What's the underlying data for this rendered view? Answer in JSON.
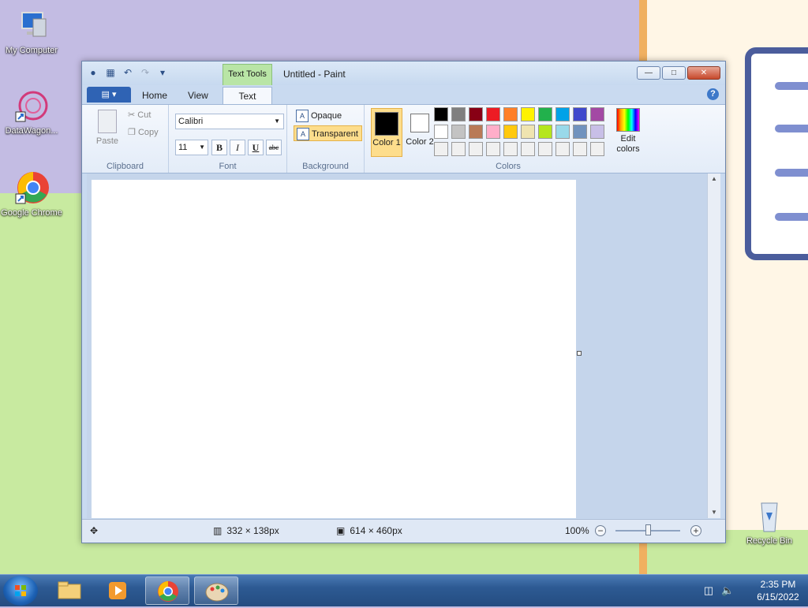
{
  "desktop": {
    "icons": [
      {
        "label": "My Computer"
      },
      {
        "label": "DataWagon..."
      },
      {
        "label": "Google Chrome"
      },
      {
        "label": "Recycle Bin"
      }
    ]
  },
  "window": {
    "title": "Untitled - Paint",
    "contextual_tab": "Text Tools",
    "tabs": [
      {
        "label": "Home"
      },
      {
        "label": "View"
      },
      {
        "label": "Text"
      }
    ],
    "active_tab": "Text"
  },
  "ribbon": {
    "clipboard": {
      "label": "Clipboard",
      "paste": "Paste",
      "cut": "Cut",
      "copy": "Copy"
    },
    "font": {
      "label": "Font",
      "family": "Calibri",
      "size": "11",
      "bold": "B",
      "italic": "I",
      "underline": "U",
      "strike": "abc"
    },
    "background": {
      "label": "Background",
      "opaque": "Opaque",
      "transparent": "Transparent"
    },
    "colors": {
      "label": "Colors",
      "color1": "Color 1",
      "color2": "Color 2",
      "edit": "Edit colors",
      "color1_value": "#000000",
      "color2_value": "#ffffff",
      "palette": [
        "#000000",
        "#7f7f7f",
        "#880015",
        "#ed1c24",
        "#ff7f27",
        "#fff200",
        "#22b14c",
        "#00a2e8",
        "#3f48cc",
        "#a349a4",
        "#ffffff",
        "#c3c3c3",
        "#b97a57",
        "#ffaec9",
        "#ffc90e",
        "#efe4b0",
        "#b5e61d",
        "#99d9ea",
        "#7092be",
        "#c8bfe7",
        "#f0f0f0",
        "#f0f0f0",
        "#f0f0f0",
        "#f0f0f0",
        "#f0f0f0",
        "#f0f0f0",
        "#f0f0f0",
        "#f0f0f0",
        "#f0f0f0",
        "#f0f0f0"
      ]
    }
  },
  "status": {
    "selection_size": "332 × 138px",
    "canvas_size": "614 × 460px",
    "zoom": "100%"
  },
  "taskbar": {
    "time": "2:35 PM",
    "date": "6/15/2022"
  }
}
